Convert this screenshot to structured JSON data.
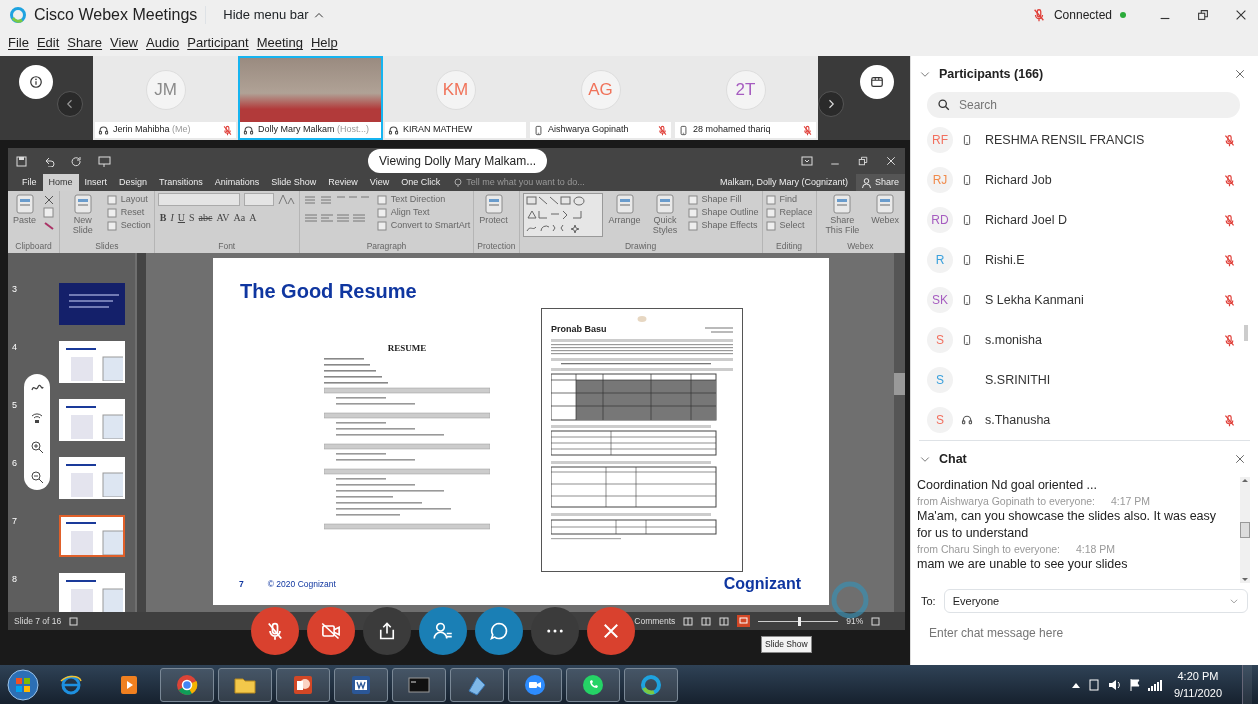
{
  "title_bar": {
    "app_title": "Cisco Webex Meetings",
    "menu_toggle": "Hide menu bar",
    "audio_muted": true,
    "status": "Connected",
    "connected": true
  },
  "menu": [
    "File",
    "Edit",
    "Share",
    "View",
    "Audio",
    "Participant",
    "Meeting",
    "Help"
  ],
  "video_strip": [
    {
      "initials": "JM",
      "color": "#8a8a8a",
      "name": "Jerin Mahibha",
      "role": "(Me)",
      "kind": "headset",
      "muted": true,
      "video": false,
      "selected": false
    },
    {
      "name": "Dolly Mary Malkam",
      "role": "(Host...)",
      "kind": "headset",
      "muted": false,
      "video": true,
      "selected": true
    },
    {
      "initials": "KM",
      "color": "#f0735a",
      "name": "KIRAN MATHEW",
      "kind": "headset",
      "muted": false,
      "video": false,
      "selected": false
    },
    {
      "initials": "AG",
      "color": "#f0735a",
      "name": "Aishwarya Gopinath",
      "kind": "phone",
      "muted": true,
      "video": false,
      "selected": false
    },
    {
      "initials": "2T",
      "color": "#a65cc0",
      "name": "28 mohamed thariq",
      "kind": "phone",
      "muted": true,
      "video": false,
      "selected": false
    }
  ],
  "shared_screen": {
    "viewing_banner": "Viewing Dolly Mary Malkam...",
    "tabs": [
      {
        "label": "File",
        "selected": false
      },
      {
        "label": "Home",
        "selected": true
      },
      {
        "label": "Insert",
        "selected": false
      },
      {
        "label": "Design",
        "selected": false
      },
      {
        "label": "Transitions",
        "selected": false
      },
      {
        "label": "Animations",
        "selected": false
      },
      {
        "label": "Slide Show",
        "selected": false
      },
      {
        "label": "Review",
        "selected": false
      },
      {
        "label": "View",
        "selected": false
      },
      {
        "label": "One Click",
        "selected": false
      }
    ],
    "tell_me": "Tell me what you want to do...",
    "user": "Malkam, Dolly Mary (Cognizant)",
    "share": "Share",
    "ribbon_groups": [
      {
        "label": "Clipboard",
        "items": [
          {
            "kind": "large",
            "text": "Paste"
          },
          {
            "kind": "tools"
          }
        ]
      },
      {
        "label": "Slides",
        "items": [
          {
            "kind": "large",
            "text": "New Slide"
          },
          {
            "kind": "small",
            "text": "Layout"
          },
          {
            "kind": "small",
            "text": "Reset"
          },
          {
            "kind": "small",
            "text": "Section"
          }
        ]
      },
      {
        "label": "Font",
        "items": [
          {
            "kind": "font"
          },
          {
            "kind": "glyph",
            "text": "B"
          },
          {
            "kind": "glyph",
            "text": "I"
          },
          {
            "kind": "glyph",
            "text": "U"
          },
          {
            "kind": "glyph",
            "text": "S"
          },
          {
            "kind": "glyph",
            "text": "abc"
          },
          {
            "kind": "glyph",
            "text": "AV"
          },
          {
            "kind": "glyph",
            "text": "Aa"
          },
          {
            "kind": "glyph",
            "text": "A"
          }
        ]
      },
      {
        "label": "Paragraph",
        "items": [
          {
            "kind": "paragraph"
          },
          {
            "kind": "small",
            "text": "Text Direction"
          },
          {
            "kind": "small",
            "text": "Align Text"
          },
          {
            "kind": "small",
            "text": "Convert to SmartArt"
          }
        ]
      },
      {
        "label": "Protection",
        "items": [
          {
            "kind": "large",
            "text": "Protect"
          }
        ]
      },
      {
        "label": "Drawing",
        "items": [
          {
            "kind": "shapes"
          },
          {
            "kind": "large",
            "text": "Arrange"
          },
          {
            "kind": "large",
            "text": "Quick Styles"
          },
          {
            "kind": "small",
            "text": "Shape Fill"
          },
          {
            "kind": "small",
            "text": "Shape Outline"
          },
          {
            "kind": "small",
            "text": "Shape Effects"
          }
        ]
      },
      {
        "label": "Editing",
        "items": [
          {
            "kind": "small",
            "text": "Find"
          },
          {
            "kind": "small",
            "text": "Replace"
          },
          {
            "kind": "small",
            "text": "Select"
          }
        ]
      },
      {
        "label": "Webex",
        "items": [
          {
            "kind": "large",
            "text": "Share This File"
          },
          {
            "kind": "large",
            "text": "Webex"
          }
        ]
      }
    ],
    "thumbnails": [
      {
        "number": "3",
        "kind": "dark",
        "selected": false
      },
      {
        "number": "4",
        "kind": "light",
        "selected": false
      },
      {
        "number": "5",
        "kind": "light",
        "selected": false
      },
      {
        "number": "6",
        "kind": "light",
        "selected": false
      },
      {
        "number": "7",
        "kind": "light",
        "selected": true
      },
      {
        "number": "8",
        "kind": "light",
        "selected": false
      }
    ],
    "slide": {
      "title": "The Good Resume",
      "left_doc_heading": "RESUME",
      "right_doc_name": "Pronab Basu",
      "page_number": "7",
      "copyright": "© 2020 Cognizant",
      "logo": "Cognizant"
    },
    "status": {
      "slide_info": "Slide 7 of 16",
      "comments": "Comments",
      "zoom": "91%",
      "level": 0.5,
      "tooltip": "Slide Show"
    },
    "controls": [
      {
        "kind": "mute"
      },
      {
        "kind": "video"
      },
      {
        "kind": "share"
      },
      {
        "kind": "participants"
      },
      {
        "kind": "chat"
      },
      {
        "kind": "more"
      },
      {
        "kind": "end"
      }
    ]
  },
  "participants_panel": {
    "title": "Participants (166)",
    "search_placeholder": "Search",
    "items": [
      {
        "initials": "RF",
        "color": "#f26f5e",
        "kind": "phone",
        "name": "RESHMA RENSIL FRANCIS",
        "muted": true
      },
      {
        "initials": "RJ",
        "color": "#f08a4b",
        "kind": "phone",
        "name": "Richard Job",
        "muted": true
      },
      {
        "initials": "RD",
        "color": "#a65cc0",
        "kind": "phone",
        "name": "Richard Joel D",
        "muted": true
      },
      {
        "initials": "R",
        "color": "#3aa0dc",
        "kind": "phone",
        "name": "Rishi.E",
        "muted": true
      },
      {
        "initials": "SK",
        "color": "#a65cc0",
        "kind": "phone",
        "name": "S Lekha Kanmani",
        "muted": true
      },
      {
        "initials": "S",
        "color": "#f26f5e",
        "kind": "phone",
        "name": "s.monisha",
        "muted": true
      },
      {
        "initials": "S",
        "color": "#3aa0dc",
        "kind": "none",
        "name": "S.SRINITHI",
        "muted": false
      },
      {
        "initials": "S",
        "color": "#f26f5e",
        "kind": "headset",
        "name": "s.Thanusha",
        "muted": true
      }
    ]
  },
  "chat_panel": {
    "title": "Chat",
    "messages": [
      {
        "kind": "text",
        "text": "Coordination Nd goal oriented ..."
      },
      {
        "kind": "meta",
        "from": "from Aishwarya Gopinath to everyone:",
        "time": "4:17 PM"
      },
      {
        "kind": "text",
        "text": "Ma'am, can you showcase the slides also. It was easy for us to understand"
      },
      {
        "kind": "meta",
        "from": "from Charu Singh to everyone:",
        "time": "4:18 PM"
      },
      {
        "kind": "text",
        "text": "mam we are unable to see your slides"
      }
    ],
    "to_label": "To:",
    "recipient": "Everyone",
    "placeholder": "Enter chat message here"
  },
  "taskbar": {
    "apps": [
      {
        "kind": "ie",
        "selected": false
      },
      {
        "kind": "media",
        "selected": false
      },
      {
        "kind": "round",
        "selected": true
      },
      {
        "kind": "folder",
        "selected": true
      },
      {
        "kind": "slides",
        "selected": true
      },
      {
        "kind": "doc",
        "selected": true
      },
      {
        "kind": "terminal",
        "selected": true
      },
      {
        "kind": "notes",
        "selected": true
      },
      {
        "kind": "camera",
        "selected": true
      },
      {
        "kind": "phonechat",
        "selected": true
      },
      {
        "kind": "ring",
        "selected": true
      }
    ],
    "time": "4:20 PM",
    "date": "9/11/2020"
  }
}
